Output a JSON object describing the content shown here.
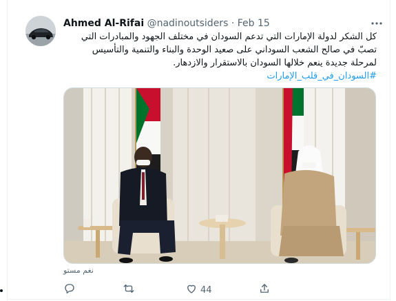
{
  "tweet": {
    "author": {
      "name": "Ahmed Al-Rifai",
      "handle": "@nadinoutsiders"
    },
    "separator": "·",
    "date": "Feb 15",
    "text_lines": [
      "كل الشكر لدولة الإمارات التي تدعم السودان في مختلف الجهود والمبادرات التي",
      "تصبّ في صالح الشعب السوداني على صعيد الوحدة والبناء والتنمية والتأسيس",
      "لمرحلة جديدة ينعم خلالها السودان بالاستقرار والازدهار."
    ],
    "hashtag": "#السودان_في_قلب_الإمارات",
    "media_alt": "نغم مستو",
    "actions": {
      "reply_count": "",
      "retweet_count": "",
      "like_count": "44"
    }
  },
  "colors": {
    "accent": "#1d9bf0",
    "secondary_text": "#536471",
    "border": "#cfd9de"
  },
  "icons": [
    "more-icon",
    "reply-icon",
    "retweet-icon",
    "like-icon",
    "share-icon"
  ]
}
